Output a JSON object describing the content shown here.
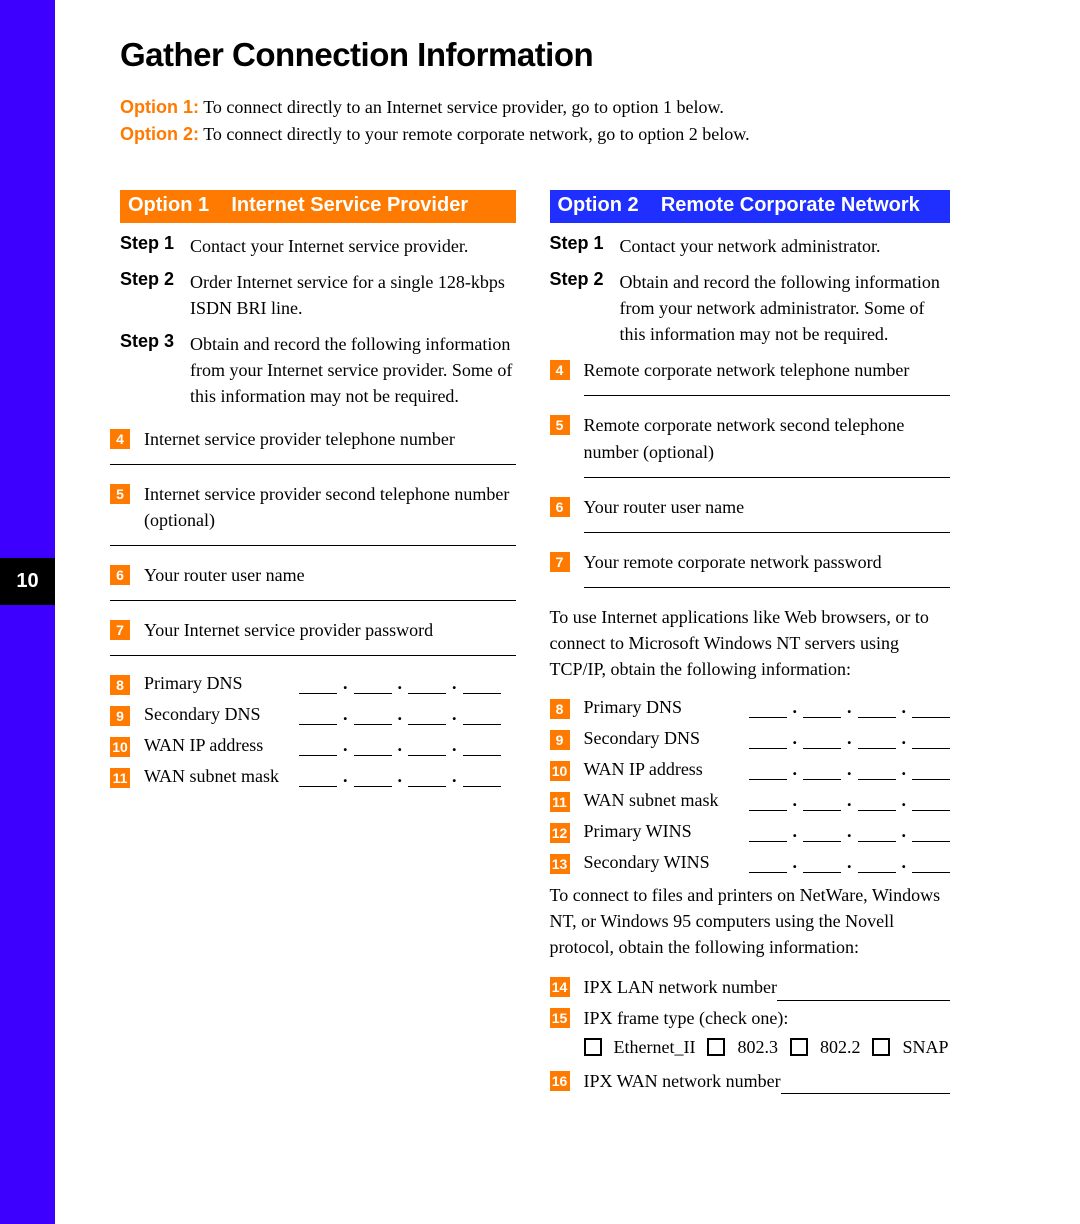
{
  "page_number": "10",
  "title": "Gather Connection Information",
  "intro": {
    "opt1_label": "Option 1:",
    "opt1_text": "To connect directly to an Internet service provider, go to option 1 below.",
    "opt2_label": "Option 2:",
    "opt2_text": "To connect directly to your remote corporate network, go to option 2 below."
  },
  "col1": {
    "header_opt": "Option 1",
    "header_title": "Internet Service Provider",
    "steps": [
      {
        "label": "Step 1",
        "text": "Contact your Internet service provider."
      },
      {
        "label": "Step 2",
        "text": "Order Internet service for a single 128-kbps ISDN BRI line."
      },
      {
        "label": "Step 3",
        "text": "Obtain and record the following information from your Internet service provider. Some of this information may not be required."
      }
    ],
    "items": {
      "n4": "4",
      "t4": "Internet service provider telephone number",
      "n5": "5",
      "t5": "Internet service provider second telephone number (optional)",
      "n6": "6",
      "t6": "Your router user name",
      "n7": "7",
      "t7": "Your Internet service provider password",
      "n8": "8",
      "t8": "Primary DNS",
      "n9": "9",
      "t9": "Secondary DNS",
      "n10": "10",
      "t10": "WAN IP address",
      "n11": "11",
      "t11": "WAN subnet mask"
    }
  },
  "col2": {
    "header_opt": "Option 2",
    "header_title": "Remote Corporate Network",
    "steps": [
      {
        "label": "Step 1",
        "text": "Contact your network administrator."
      },
      {
        "label": "Step 2",
        "text": "Obtain and record the following information from your network administrator. Some of this information may not be required."
      }
    ],
    "items": {
      "n4": "4",
      "t4": "Remote corporate network telephone number",
      "n5": "5",
      "t5": "Remote corporate network second telephone number (optional)",
      "n6": "6",
      "t6": "Your router user name",
      "n7": "7",
      "t7": "Your remote corporate network password"
    },
    "para1": "To use Internet applications like Web browsers, or to connect to Microsoft Windows NT servers using TCP/IP, obtain the following information:",
    "ipitems": {
      "n8": "8",
      "t8": "Primary DNS",
      "n9": "9",
      "t9": "Secondary DNS",
      "n10": "10",
      "t10": "WAN IP address",
      "n11": "11",
      "t11": "WAN subnet mask",
      "n12": "12",
      "t12": "Primary WINS",
      "n13": "13",
      "t13": "Secondary WINS"
    },
    "para2": "To connect to files and printers on NetWare, Windows NT, or Windows 95 computers using the Novell protocol, obtain the following information:",
    "ipx": {
      "n14": "14",
      "t14": "IPX LAN network number",
      "n15": "15",
      "t15": "IPX frame type (check one):",
      "c1": "Ethernet_II",
      "c2": "802.3",
      "c3": "802.2",
      "c4": "SNAP",
      "n16": "16",
      "t16": "IPX WAN network number"
    }
  }
}
